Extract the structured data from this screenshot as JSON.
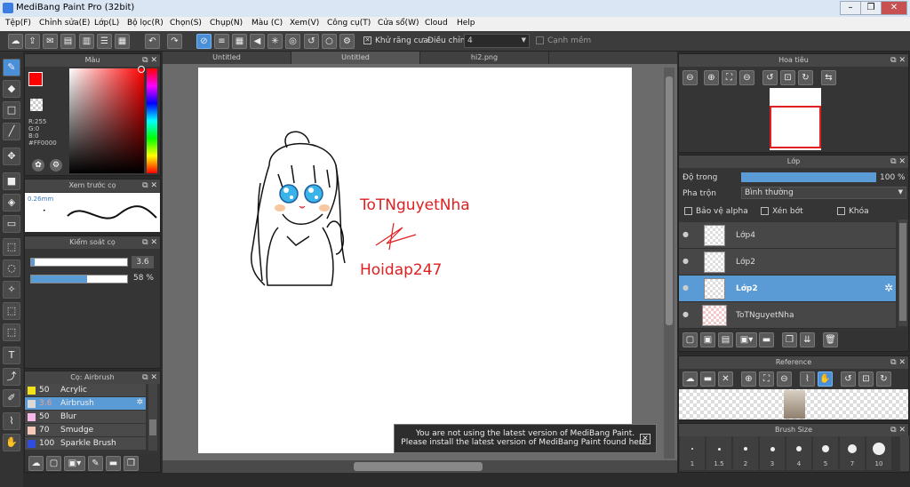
{
  "app": {
    "title": "MediBang Paint Pro (32bit)"
  },
  "menu": [
    "Tệp(F)",
    "Chỉnh sửa(E)",
    "Lớp(L)",
    "Bộ lọc(R)",
    "Chọn(S)",
    "Chụp(N)",
    "Màu (C)",
    "Xem(V)",
    "Công cụ(T)",
    "Cửa sổ(W)",
    "Cloud",
    "Help"
  ],
  "toolbar": {
    "antialias_label": "Khử răng cưa",
    "adjust_label": "Điều chỉnh",
    "adjust_value": "4",
    "smooth_label": "Cạnh mềm"
  },
  "color_panel": {
    "title": "Màu",
    "r": "R:255",
    "g": "G:0",
    "b": "B:0",
    "hex": "#FF0000",
    "primary": "#ff0000",
    "secondary": "#000000"
  },
  "preview_panel": {
    "title": "Xem trước cọ",
    "size": "0.26mm"
  },
  "control_panel": {
    "title": "Kiểm soát cọ",
    "size_value": "3.6",
    "opacity_value": "58 %",
    "opacity_fraction": 0.58
  },
  "brush_panel": {
    "title": "Cọ: Airbrush",
    "items": [
      {
        "size": "50",
        "name": "Acrylic",
        "color": "#f2e21c"
      },
      {
        "size": "3.6",
        "name": "Airbrush",
        "color": "#d9d9d9"
      },
      {
        "size": "50",
        "name": "Blur",
        "color": "#f6b8e8"
      },
      {
        "size": "70",
        "name": "Smudge",
        "color": "#f6c9b8"
      },
      {
        "size": "100",
        "name": "Sparkle Brush",
        "color": "#2f4de0"
      }
    ]
  },
  "tabs": [
    "Untitled",
    "Untitled",
    "hi2.png"
  ],
  "artwork": {
    "text1": "ToTNguyetNha",
    "text2": "Hoidap247"
  },
  "notice": {
    "line1": "You are not using the latest version of MediBang Paint.",
    "line2": "Please install the latest version of MediBang Paint found here."
  },
  "navigator": {
    "title": "Hoa tiêu"
  },
  "layers": {
    "title": "Lớp",
    "opacity_label": "Độ trong",
    "opacity_value": "100 %",
    "opacity_fraction": 1.0,
    "blend_label": "Pha trộn",
    "blend_value": "Bình thường",
    "protect_alpha": "Bảo vệ alpha",
    "clipping": "Xén bớt",
    "lock": "Khóa",
    "items": [
      {
        "name": "Lớp4"
      },
      {
        "name": "Lớp2"
      },
      {
        "name": "Lớp2"
      },
      {
        "name": "ToTNguyetNha"
      }
    ]
  },
  "reference": {
    "title": "Reference"
  },
  "brush_size": {
    "title": "Brush Size",
    "sizes": [
      "1",
      "1.5",
      "2",
      "3",
      "4",
      "5",
      "7",
      "10"
    ]
  }
}
